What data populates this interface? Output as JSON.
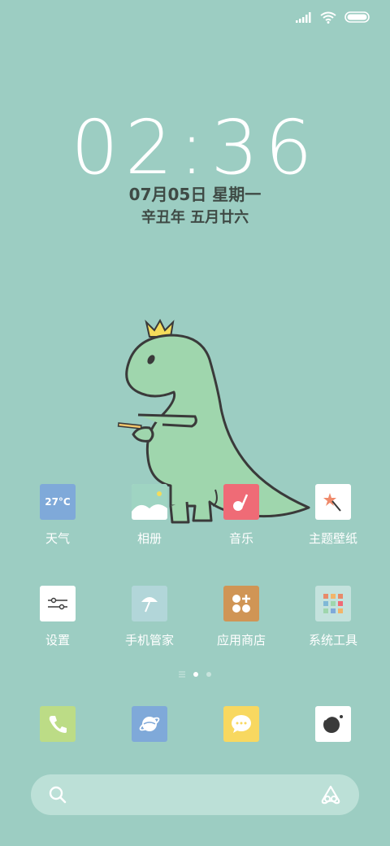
{
  "status": {
    "signal_icon": "signal-icon",
    "wifi_icon": "wifi-icon",
    "battery_icon": "battery-icon"
  },
  "lockscreen": {
    "time": "02:36",
    "date": "07月05日 星期一",
    "lunar": "辛丑年 五月廿六"
  },
  "apps_row1": [
    {
      "label": "天气",
      "icon": "weather-icon",
      "badge": "27°C"
    },
    {
      "label": "相册",
      "icon": "gallery-icon"
    },
    {
      "label": "音乐",
      "icon": "music-icon"
    },
    {
      "label": "主题壁纸",
      "icon": "theme-icon"
    }
  ],
  "apps_row2": [
    {
      "label": "设置",
      "icon": "settings-icon"
    },
    {
      "label": "手机管家",
      "icon": "security-icon"
    },
    {
      "label": "应用商店",
      "icon": "app-store-icon"
    },
    {
      "label": "系统工具",
      "icon": "tools-icon"
    }
  ],
  "dock": [
    {
      "icon": "phone-icon"
    },
    {
      "icon": "browser-icon"
    },
    {
      "icon": "messages-icon"
    },
    {
      "icon": "camera-icon"
    }
  ],
  "search": {
    "icon": "search-icon",
    "assistant_icon": "assistant-icon"
  },
  "colors": {
    "background": "#9ccdc2",
    "dino": "#9fd6ad",
    "outline": "#3a3a3a"
  }
}
